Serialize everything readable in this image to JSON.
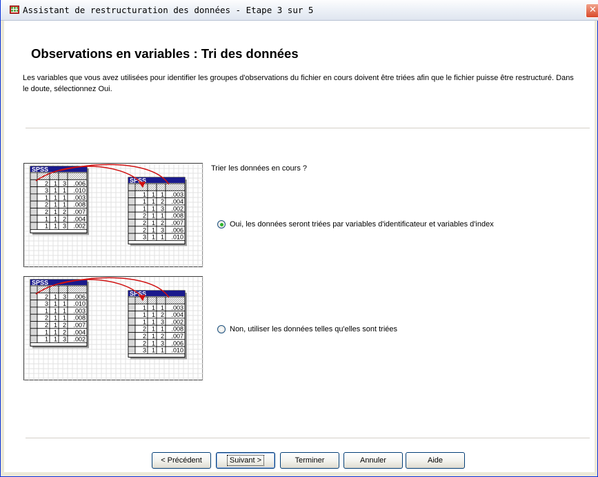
{
  "window": {
    "title": "Assistant de restructuration des données - Etape 3 sur 5",
    "close_symbol": "✕"
  },
  "main": {
    "heading": "Observations en variables : Tri des données",
    "description": "Les variables que vous avez utilisées pour identifier les groupes d'observations du fichier en cours doivent être triées afin que le fichier puisse être restructuré. Dans le doute, sélectionnez Oui.",
    "prompt": "Trier les données en cours ?"
  },
  "preview": {
    "window_label": "SPSS",
    "left_table": [
      [
        "2",
        "1",
        "3",
        ".006"
      ],
      [
        "3",
        "1",
        "1",
        ".010"
      ],
      [
        "1",
        "1",
        "1",
        ".003"
      ],
      [
        "2",
        "1",
        "1",
        ".008"
      ],
      [
        "2",
        "1",
        "2",
        ".007"
      ],
      [
        "1",
        "1",
        "2",
        ".004"
      ],
      [
        "1",
        "1",
        "3",
        ".002"
      ]
    ],
    "right_table": [
      [
        "1",
        "1",
        "1",
        ".003"
      ],
      [
        "1",
        "1",
        "2",
        ".004"
      ],
      [
        "1",
        "1",
        "3",
        ".002"
      ],
      [
        "2",
        "1",
        "1",
        ".008"
      ],
      [
        "2",
        "1",
        "2",
        ".007"
      ],
      [
        "2",
        "1",
        "3",
        ".006"
      ],
      [
        "3",
        "1",
        "1",
        ".010"
      ]
    ]
  },
  "options": {
    "yes_label": "Oui, les données seront triées par variables d'identificateur et variables d'index",
    "no_label": "Non, utiliser les données telles qu'elles sont triées",
    "selected": "yes"
  },
  "buttons": {
    "previous": "< Précédent",
    "next": "Suivant >",
    "finish": "Terminer",
    "cancel": "Annuler",
    "help": "Aide"
  },
  "colors": {
    "titlebar_blue": "#0831d9",
    "arrow_red": "#d01010",
    "mini_title": "#1a1a8c"
  }
}
